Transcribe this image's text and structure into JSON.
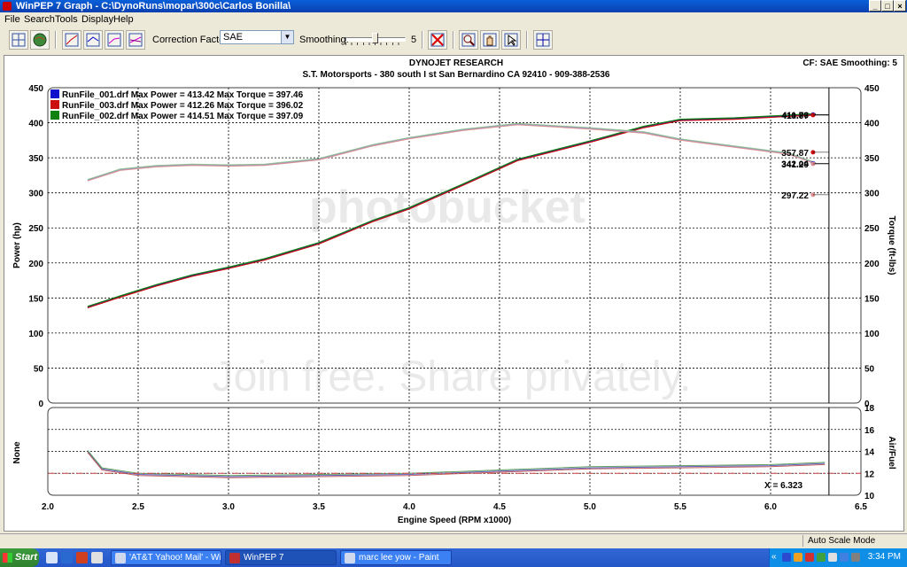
{
  "window": {
    "title": "WinPEP 7    Graph - C:\\DynoRuns\\mopar\\300c\\Carlos Bonilla\\",
    "min_glyph": "_",
    "max_glyph": "□",
    "close_glyph": "×"
  },
  "menu": [
    "File",
    "Search",
    "Tools",
    "Display",
    "Help"
  ],
  "toolbar": {
    "correction_label": "Correction Factor:",
    "correction_value": "SAE",
    "smoothing_label": "Smoothing:",
    "smoothing_value": "5",
    "smoothing_level": 5,
    "smoothing_max": 10
  },
  "graph": {
    "header_title": "DYNOJET RESEARCH",
    "header_subtitle": "S.T. Motorsports   - 380 south I st San Bernardino CA 92410 - 909-388-2536",
    "header_right": "CF: SAE  Smoothing: 5",
    "watermark_logo": "photobucket",
    "watermark_text": "Join free. Share privately.",
    "legend": [
      {
        "label": "RunFile_001.drf Max Power = 413.42 Max Torque = 397.46",
        "color": "#1010cc"
      },
      {
        "label": "RunFile_003.drf Max Power = 412.26 Max Torque = 396.02",
        "color": "#cc1010"
      },
      {
        "label": "RunFile_002.drf Max Power = 414.51 Max Torque = 397.09",
        "color": "#108010"
      }
    ],
    "cursor_x_label": "X = 6.323",
    "cursor_values": [
      {
        "value": "411.76",
        "y": 411.76,
        "color": "#1010cc"
      },
      {
        "value": "410.87",
        "y": 410.87,
        "color": "#cc1010"
      },
      {
        "value": "357.87",
        "y": 357.87,
        "color": "#cc1010"
      },
      {
        "value": "342.04",
        "y": 342.04,
        "color": "#1010cc"
      },
      {
        "value": "341.29",
        "y": 341.29,
        "color": "#e09090"
      },
      {
        "value": "297.22",
        "y": 297.22,
        "color": "#e09090"
      }
    ]
  },
  "chart_data": [
    {
      "type": "line",
      "xlabel": "Engine Speed (RPM x1000)",
      "ylabel": "Power (hp)",
      "y2label": "Torque (ft-lbs)",
      "xlim": [
        2.0,
        6.5
      ],
      "ylim": [
        0,
        450
      ],
      "x_ticks": [
        "2.0",
        "2.5",
        "3.0",
        "3.5",
        "4.0",
        "4.5",
        "5.0",
        "5.5",
        "6.0",
        "6.5"
      ],
      "y_ticks": [
        "0",
        "50",
        "100",
        "150",
        "200",
        "250",
        "300",
        "350",
        "400",
        "450"
      ],
      "grid": true,
      "series": [
        {
          "name": "RunFile_001.drf",
          "quantity": "power",
          "color": "#1010cc",
          "x": [
            2.22,
            2.4,
            2.6,
            2.8,
            3.0,
            3.2,
            3.5,
            3.8,
            4.0,
            4.3,
            4.6,
            5.0,
            5.3,
            5.5,
            5.8,
            6.1,
            6.25
          ],
          "y": [
            137,
            152,
            168,
            182,
            193,
            205,
            228,
            260,
            278,
            312,
            347,
            373,
            394,
            404,
            406,
            410,
            412
          ]
        },
        {
          "name": "RunFile_003.drf",
          "quantity": "power",
          "color": "#cc1010",
          "x": [
            2.22,
            2.4,
            2.6,
            2.8,
            3.0,
            3.2,
            3.5,
            3.8,
            4.0,
            4.3,
            4.6,
            5.0,
            5.3,
            5.5,
            5.8,
            6.1,
            6.25
          ],
          "y": [
            136,
            151,
            167,
            181,
            192,
            204,
            227,
            259,
            277,
            311,
            346,
            372,
            393,
            403,
            405,
            409,
            411
          ]
        },
        {
          "name": "RunFile_002.drf",
          "quantity": "power",
          "color": "#108010",
          "x": [
            2.22,
            2.4,
            2.6,
            2.8,
            3.0,
            3.2,
            3.5,
            3.8,
            4.0,
            4.3,
            4.6,
            5.0,
            5.3,
            5.5,
            5.8,
            6.1,
            6.25
          ],
          "y": [
            138,
            153,
            169,
            183,
            194,
            206,
            229,
            261,
            279,
            313,
            348,
            374,
            395,
            405,
            407,
            411,
            413
          ]
        },
        {
          "name": "RunFile_001.drf",
          "quantity": "torque",
          "color": "#9090d0",
          "x": [
            2.22,
            2.4,
            2.6,
            2.8,
            3.0,
            3.2,
            3.5,
            3.8,
            4.0,
            4.3,
            4.6,
            5.0,
            5.3,
            5.5,
            5.8,
            6.1,
            6.25
          ],
          "y": [
            318,
            333,
            338,
            340,
            339,
            340,
            348,
            368,
            378,
            390,
            398,
            392,
            386,
            376,
            366,
            356,
            342
          ]
        },
        {
          "name": "RunFile_003.drf",
          "quantity": "torque",
          "color": "#e09090",
          "x": [
            2.22,
            2.4,
            2.6,
            2.8,
            3.0,
            3.2,
            3.5,
            3.8,
            4.0,
            4.3,
            4.6,
            5.0,
            5.3,
            5.5,
            5.8,
            6.1,
            6.25
          ],
          "y": [
            317,
            332,
            337,
            339,
            338,
            339,
            347,
            367,
            377,
            389,
            397,
            391,
            385,
            375,
            365,
            355,
            341
          ]
        },
        {
          "name": "RunFile_002.drf",
          "quantity": "torque",
          "color": "#90c090",
          "x": [
            2.22,
            2.4,
            2.6,
            2.8,
            3.0,
            3.2,
            3.5,
            3.8,
            4.0,
            4.3,
            4.6,
            5.0,
            5.3,
            5.5,
            5.8,
            6.1,
            6.25
          ],
          "y": [
            319,
            334,
            339,
            341,
            340,
            341,
            349,
            369,
            379,
            391,
            399,
            393,
            387,
            377,
            367,
            357,
            343
          ]
        }
      ]
    },
    {
      "type": "line",
      "ylabel": "None",
      "y2label": "Air/Fuel",
      "xlim": [
        2.0,
        6.5
      ],
      "ylim": [
        10,
        18
      ],
      "y_ticks": [
        "10",
        "12",
        "14",
        "16",
        "18"
      ],
      "target_afr": 12,
      "grid": true,
      "series": [
        {
          "name": "RunFile_001.drf",
          "color": "#6060c0",
          "x": [
            2.22,
            2.3,
            2.5,
            3.0,
            3.5,
            4.0,
            4.5,
            5.0,
            5.5,
            6.0,
            6.3
          ],
          "y": [
            14.0,
            12.4,
            11.9,
            11.7,
            11.8,
            11.9,
            12.2,
            12.5,
            12.6,
            12.7,
            12.9
          ]
        },
        {
          "name": "RunFile_003.drf",
          "color": "#c06060",
          "x": [
            2.22,
            2.3,
            2.5,
            3.0,
            3.5,
            4.0,
            4.5,
            5.0,
            5.5,
            6.0,
            6.3
          ],
          "y": [
            13.9,
            12.3,
            11.8,
            11.6,
            11.7,
            11.8,
            12.1,
            12.4,
            12.5,
            12.6,
            12.8
          ]
        },
        {
          "name": "RunFile_002.drf",
          "color": "#60a060",
          "x": [
            2.22,
            2.3,
            2.5,
            3.0,
            3.5,
            4.0,
            4.5,
            5.0,
            5.5,
            6.0,
            6.3
          ],
          "y": [
            14.1,
            12.5,
            12.0,
            11.8,
            11.9,
            12.0,
            12.3,
            12.6,
            12.7,
            12.8,
            13.0
          ]
        }
      ]
    }
  ],
  "statusbar": {
    "right_text": "Auto Scale Mode"
  },
  "taskbar": {
    "start": "Start",
    "tasks": [
      {
        "label": "'AT&T Yahoo! Mail' - Win...",
        "active": false
      },
      {
        "label": "WinPEP 7",
        "active": true
      },
      {
        "label": "marc lee yow - Paint",
        "active": false
      }
    ],
    "clock": "3:34 PM"
  },
  "colors": {
    "titlebar": "#0A4FD0",
    "taskbar": "#2456c7",
    "target_line": "#cc4444"
  }
}
